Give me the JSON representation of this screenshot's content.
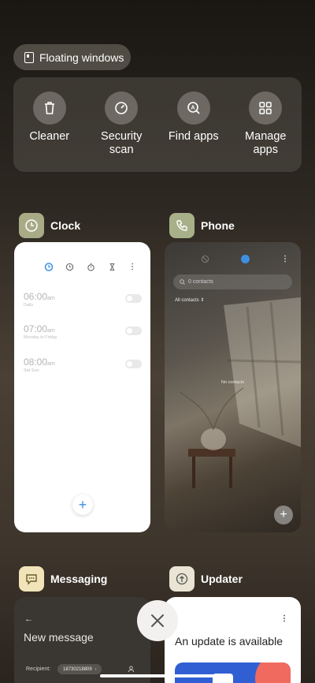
{
  "floating_windows": {
    "label": "Floating windows"
  },
  "tools": [
    {
      "label": "Cleaner",
      "icon": "trash-icon"
    },
    {
      "label": "Security scan",
      "icon": "gauge-icon"
    },
    {
      "label": "Find apps",
      "icon": "search-a-icon"
    },
    {
      "label": "Manage apps",
      "icon": "grid-icon"
    }
  ],
  "apps": {
    "clock": {
      "name": "Clock",
      "alarms": [
        {
          "time": "06:00",
          "ampm": "am",
          "repeat": "Daily"
        },
        {
          "time": "07:00",
          "ampm": "am",
          "repeat": "Monday to Friday"
        },
        {
          "time": "08:00",
          "ampm": "am",
          "repeat": "Sat Sun"
        }
      ]
    },
    "phone": {
      "name": "Phone",
      "search_placeholder": "0 contacts",
      "filter": "All contacts",
      "empty_text": "No contacts"
    },
    "messaging": {
      "name": "Messaging",
      "title": "New message",
      "recipient_label": "Recipient:",
      "recipient_value": "18730218809"
    },
    "updater": {
      "name": "Updater",
      "title": "An update is available"
    }
  },
  "colors": {
    "accent": "#3d8fe0",
    "clock_icon_bg": "#a8ab86",
    "phone_icon_bg": "#a8b08a",
    "msg_icon_bg": "#f1e4b8",
    "upd_icon_bg": "#e9e4d4"
  }
}
